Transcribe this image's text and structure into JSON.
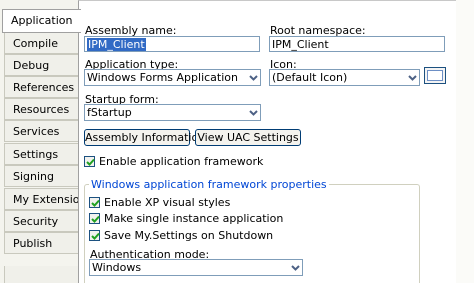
{
  "tabs": [
    {
      "label": "Application",
      "active": true
    },
    {
      "label": "Compile"
    },
    {
      "label": "Debug"
    },
    {
      "label": "References"
    },
    {
      "label": "Resources"
    },
    {
      "label": "Services"
    },
    {
      "label": "Settings"
    },
    {
      "label": "Signing"
    },
    {
      "label": "My Extensions"
    },
    {
      "label": "Security"
    },
    {
      "label": "Publish"
    }
  ],
  "assembly_name": {
    "label": "Assembly name:",
    "value": "IPM_Client"
  },
  "root_namespace": {
    "label": "Root namespace:",
    "value": "IPM_Client"
  },
  "application_type": {
    "label": "Application type:",
    "value": "Windows Forms Application"
  },
  "icon": {
    "label": "Icon:",
    "value": "(Default Icon)"
  },
  "startup_form": {
    "label": "Startup form:",
    "value": "fStartup"
  },
  "buttons": {
    "assembly_information": "Assembly Information...",
    "view_uac_settings": "View UAC Settings"
  },
  "enable_application_framework": {
    "label": "Enable application framework",
    "checked": true
  },
  "framework_group": {
    "title": "Windows application framework properties",
    "enable_xp_visual_styles": {
      "label": "Enable XP visual styles",
      "checked": true
    },
    "make_single_instance": {
      "label": "Make single instance application",
      "checked": true
    },
    "save_my_settings": {
      "label": "Save My.Settings on Shutdown",
      "checked": true
    },
    "authentication_mode": {
      "label": "Authentication mode:",
      "value": "Windows"
    }
  },
  "colors": {
    "selection": "#316ac5",
    "group_title": "#0046d5",
    "input_border": "#7f9db9"
  }
}
